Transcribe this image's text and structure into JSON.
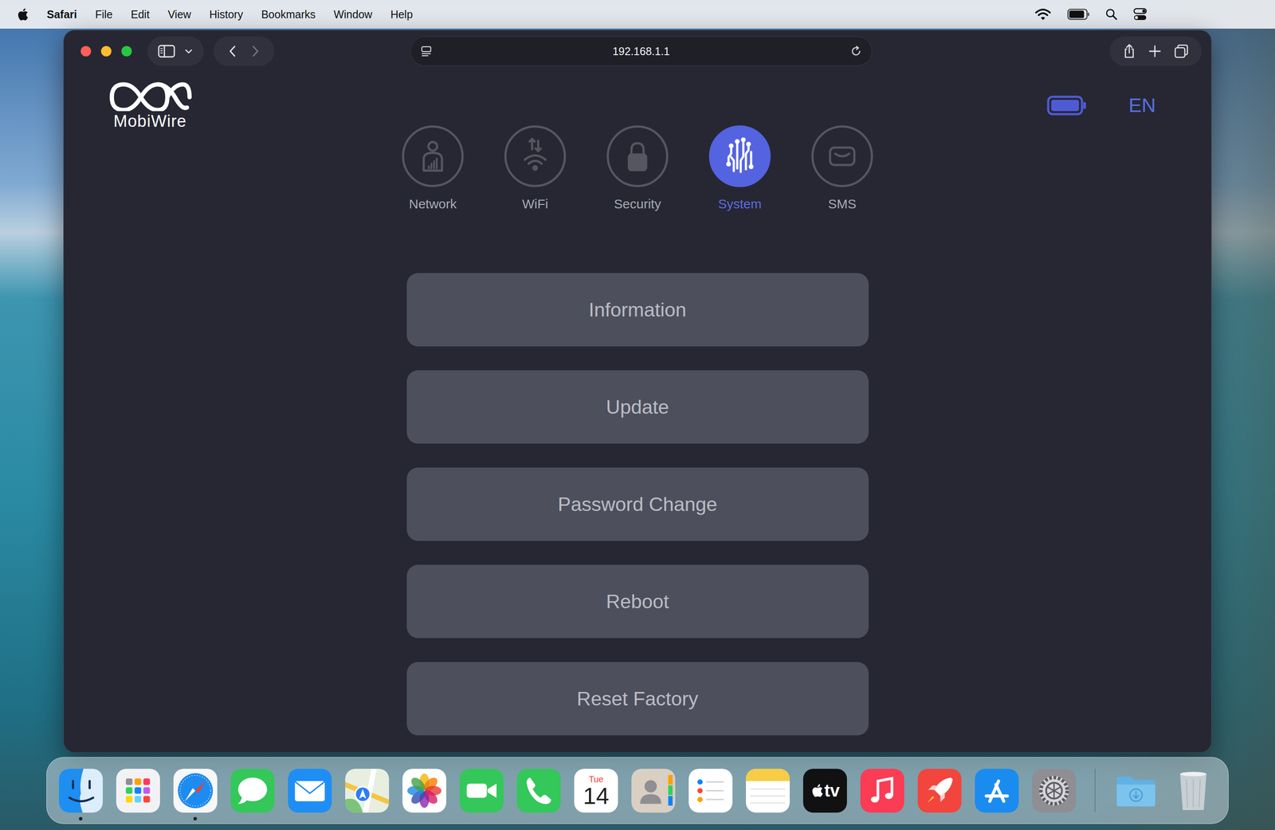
{
  "menu_bar": {
    "app": "Safari",
    "items": [
      "File",
      "Edit",
      "View",
      "History",
      "Bookmarks",
      "Window",
      "Help"
    ],
    "battery": {
      "level": 0.9
    }
  },
  "browser": {
    "url": "192.168.1.1"
  },
  "page": {
    "logo": "MobiWire",
    "battery": {
      "level": 1
    },
    "language": "EN",
    "tabs": [
      {
        "label": "Network",
        "kind": "network",
        "selected": false
      },
      {
        "label": "WiFi",
        "kind": "wifi",
        "selected": false
      },
      {
        "label": "Security",
        "kind": "security",
        "selected": false
      },
      {
        "label": "System",
        "kind": "system",
        "selected": true
      },
      {
        "label": "SMS",
        "kind": "sms",
        "selected": false
      }
    ],
    "buttons": [
      "Information",
      "Update",
      "Password Change",
      "Reboot",
      "Reset Factory"
    ]
  },
  "dock": {
    "apps": [
      {
        "kind": "finder",
        "running": true
      },
      {
        "kind": "launchpad",
        "running": false
      },
      {
        "kind": "safari",
        "running": true
      },
      {
        "kind": "messages",
        "running": false
      },
      {
        "kind": "mail",
        "running": false
      },
      {
        "kind": "maps",
        "running": false
      },
      {
        "kind": "photos",
        "running": false
      },
      {
        "kind": "facetime",
        "running": false
      },
      {
        "kind": "phone",
        "running": false
      },
      {
        "kind": "calendar",
        "running": false,
        "day": "Tue",
        "date": "14"
      },
      {
        "kind": "contacts",
        "running": false
      },
      {
        "kind": "reminders",
        "running": false
      },
      {
        "kind": "notes",
        "running": false
      },
      {
        "kind": "tv",
        "running": false,
        "label": "tv"
      },
      {
        "kind": "music",
        "running": false
      },
      {
        "kind": "rocket",
        "running": false
      },
      {
        "kind": "appstore",
        "running": false
      },
      {
        "kind": "settings",
        "running": false
      }
    ],
    "stacks": [
      {
        "kind": "downloads"
      },
      {
        "kind": "trash"
      }
    ]
  }
}
